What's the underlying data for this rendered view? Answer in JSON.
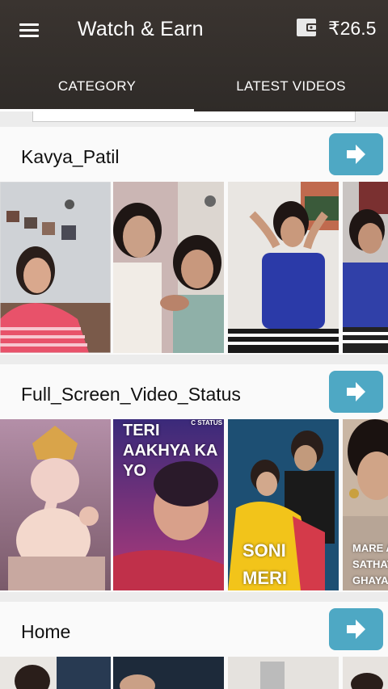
{
  "appbar": {
    "title": "Watch & Earn",
    "balance": "₹26.5",
    "menu_icon": "hamburger-menu-icon",
    "wallet_icon": "wallet-icon"
  },
  "tabs": [
    {
      "label": "CATEGORY",
      "selected": true
    },
    {
      "label": "LATEST VIDEOS",
      "selected": false
    }
  ],
  "sections": [
    {
      "title": "Kavya_Patil",
      "thumbnails": [
        {
          "overlay": ""
        },
        {
          "overlay": ""
        },
        {
          "overlay": ""
        },
        {
          "overlay": ""
        }
      ]
    },
    {
      "title": "Full_Screen_Video_Status",
      "thumbnails": [
        {
          "overlay": ""
        },
        {
          "overlay": "TERI AAKHYA KA YO",
          "badge": "C STATUS"
        },
        {
          "overlay": "SONI MERI BAAT"
        },
        {
          "overlay": "MARE A SATHAT GHAYAL"
        }
      ]
    },
    {
      "title": "Home",
      "thumbnails": [
        {
          "overlay": ""
        },
        {
          "overlay": ""
        },
        {
          "overlay": ""
        },
        {
          "overlay": ""
        }
      ]
    }
  ],
  "colors": {
    "appbar": "#332e2b",
    "accent_button": "#4ea8c4",
    "tab_indicator": "#ffffff"
  },
  "icons": {
    "section_button": "arrow-right-icon"
  }
}
